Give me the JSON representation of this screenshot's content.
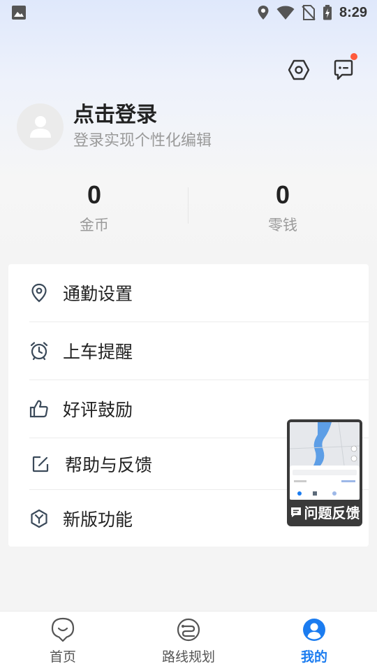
{
  "status_bar": {
    "time": "8:29"
  },
  "profile": {
    "title": "点击登录",
    "subtitle": "登录实现个性化编辑"
  },
  "stats": [
    {
      "value": "0",
      "label": "金币"
    },
    {
      "value": "0",
      "label": "零钱"
    }
  ],
  "menu": {
    "items": [
      {
        "label": "通勤设置",
        "icon": "location-pin-icon"
      },
      {
        "label": "上车提醒",
        "icon": "alarm-clock-icon"
      },
      {
        "label": "好评鼓励",
        "icon": "thumbs-up-icon"
      },
      {
        "label": "帮助与反馈",
        "icon": "edit-square-icon"
      },
      {
        "label": "新版功能",
        "icon": "hexagon-y-icon"
      }
    ]
  },
  "feedback_float": {
    "label": "问题反馈"
  },
  "bottom_nav": {
    "active": "我的",
    "items": [
      {
        "label": "首页",
        "icon": "smile-pin-icon"
      },
      {
        "label": "路线规划",
        "icon": "route-icon"
      },
      {
        "label": "我的",
        "icon": "user-icon"
      }
    ]
  },
  "colors": {
    "accent": "#1b7cf0",
    "notify_dot": "#ff5a3c"
  }
}
